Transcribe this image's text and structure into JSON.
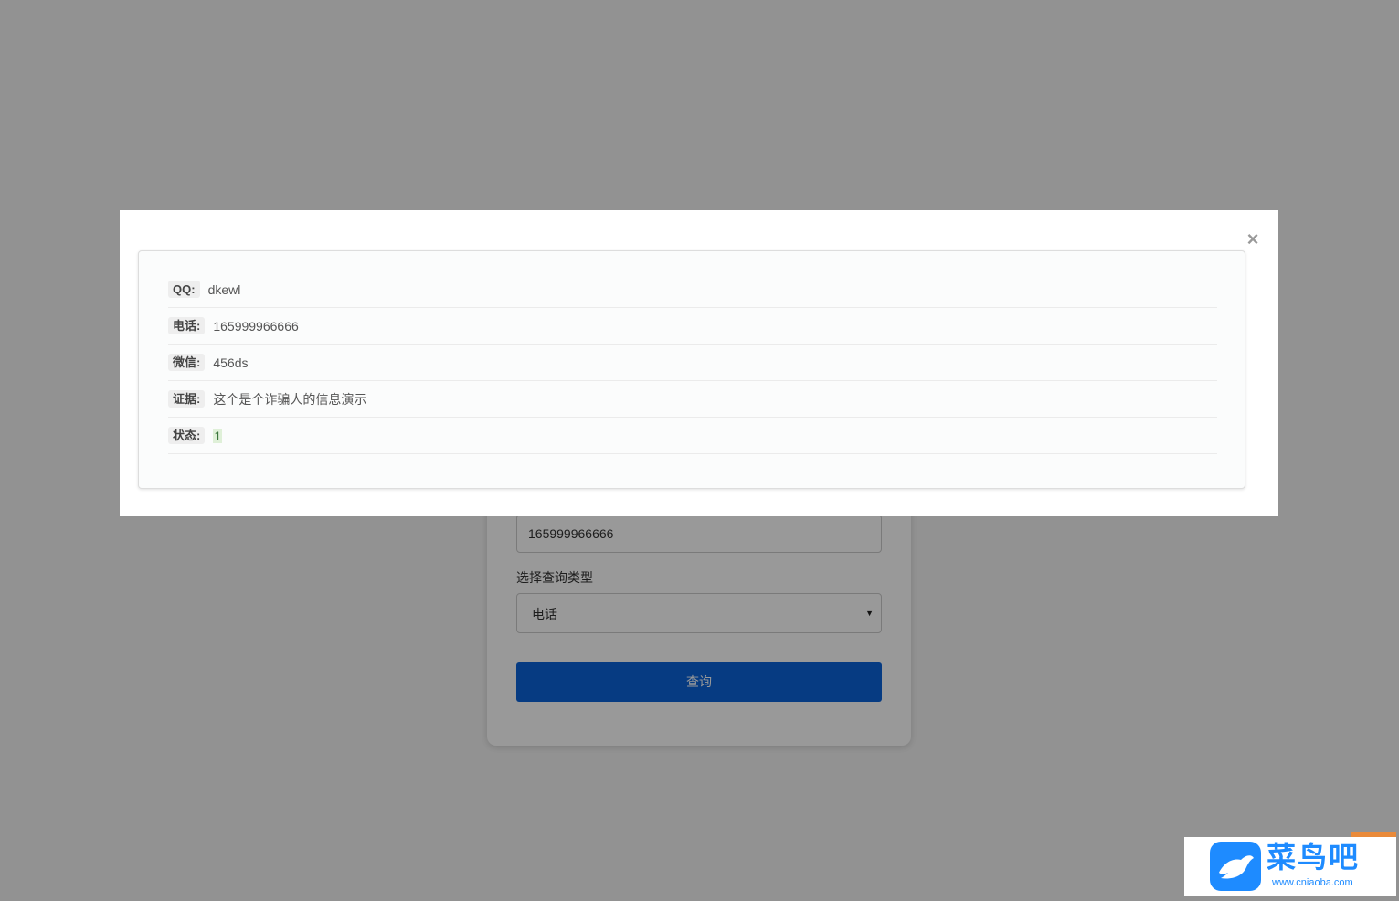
{
  "query_form": {
    "input_value": "165999966666",
    "type_label": "选择查询类型",
    "type_selected": "电话",
    "submit_label": "查询"
  },
  "result_modal": {
    "close_symbol": "×",
    "rows": [
      {
        "key": "QQ:",
        "value": "dkewl"
      },
      {
        "key": "电话:",
        "value": "165999966666"
      },
      {
        "key": "微信:",
        "value": "456ds"
      },
      {
        "key": "证据:",
        "value": "这个是个诈骗人的信息演示"
      },
      {
        "key": "状态:",
        "value": "1"
      }
    ]
  },
  "watermark": {
    "name": "菜鸟吧",
    "url": "www.cniaoba.com"
  },
  "colors": {
    "primary_button": "#0a63d9",
    "status_highlight": "#dff0d8",
    "watermark_blue": "#1e8bff"
  }
}
